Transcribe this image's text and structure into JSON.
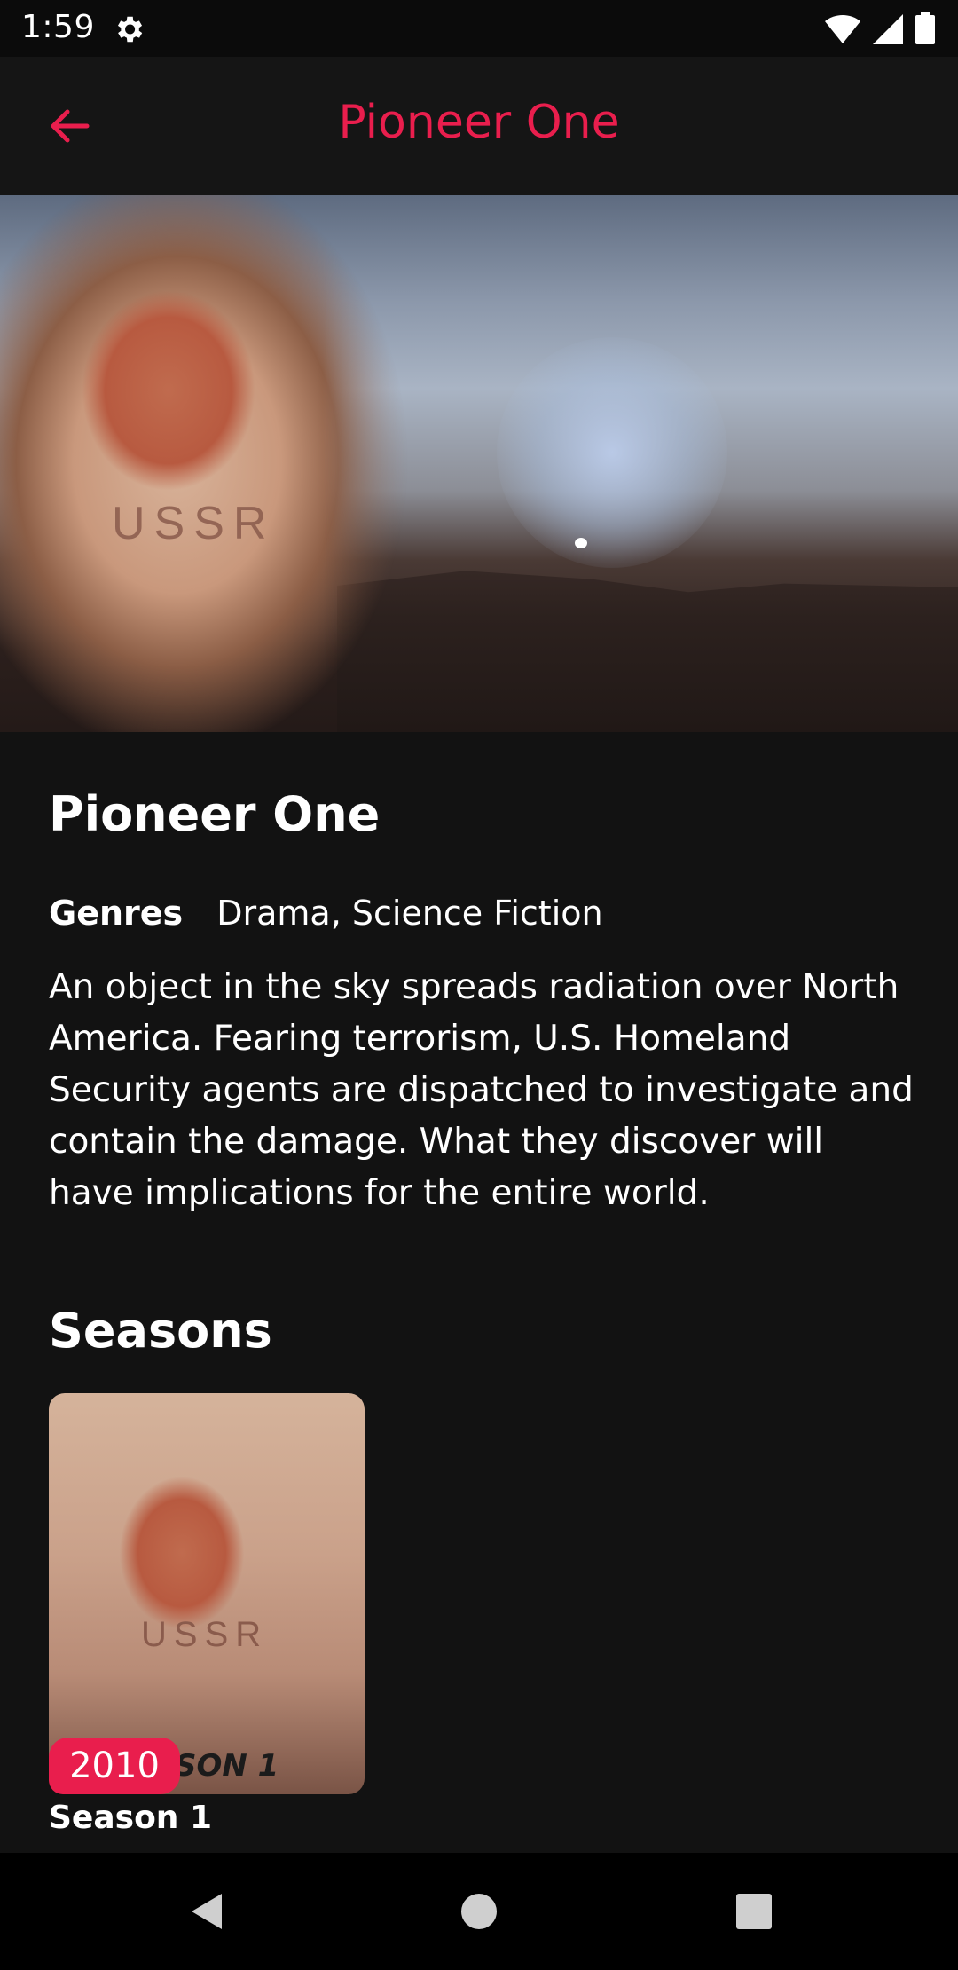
{
  "status_bar": {
    "time": "1:59",
    "icons": [
      "gear-icon",
      "wifi-icon",
      "cellular-icon",
      "battery-icon"
    ]
  },
  "app_bar": {
    "title": "Pioneer One",
    "back_icon": "arrow-left-icon"
  },
  "hero": {
    "poster_text": "USSR"
  },
  "show": {
    "title": "Pioneer One",
    "genres_label": "Genres",
    "genres_value": "Drama, Science Fiction",
    "overview": "An object in the sky spreads radiation over North America. Fearing terrorism, U.S. Homeland Security agents are dispatched to investigate and contain the damage. What they discover will have implications for the entire world."
  },
  "seasons": {
    "heading": "Seasons",
    "items": [
      {
        "year": "2010",
        "name": "Season 1",
        "poster_text": "USSR",
        "poster_caption": "SON 1"
      }
    ]
  },
  "nav_bar": {
    "buttons": [
      "back-triangle-icon",
      "home-circle-icon",
      "recents-square-icon"
    ]
  },
  "colors": {
    "accent": "#e91e4d",
    "background": "#121212",
    "app_bar": "#151515",
    "text": "#ffffff"
  }
}
